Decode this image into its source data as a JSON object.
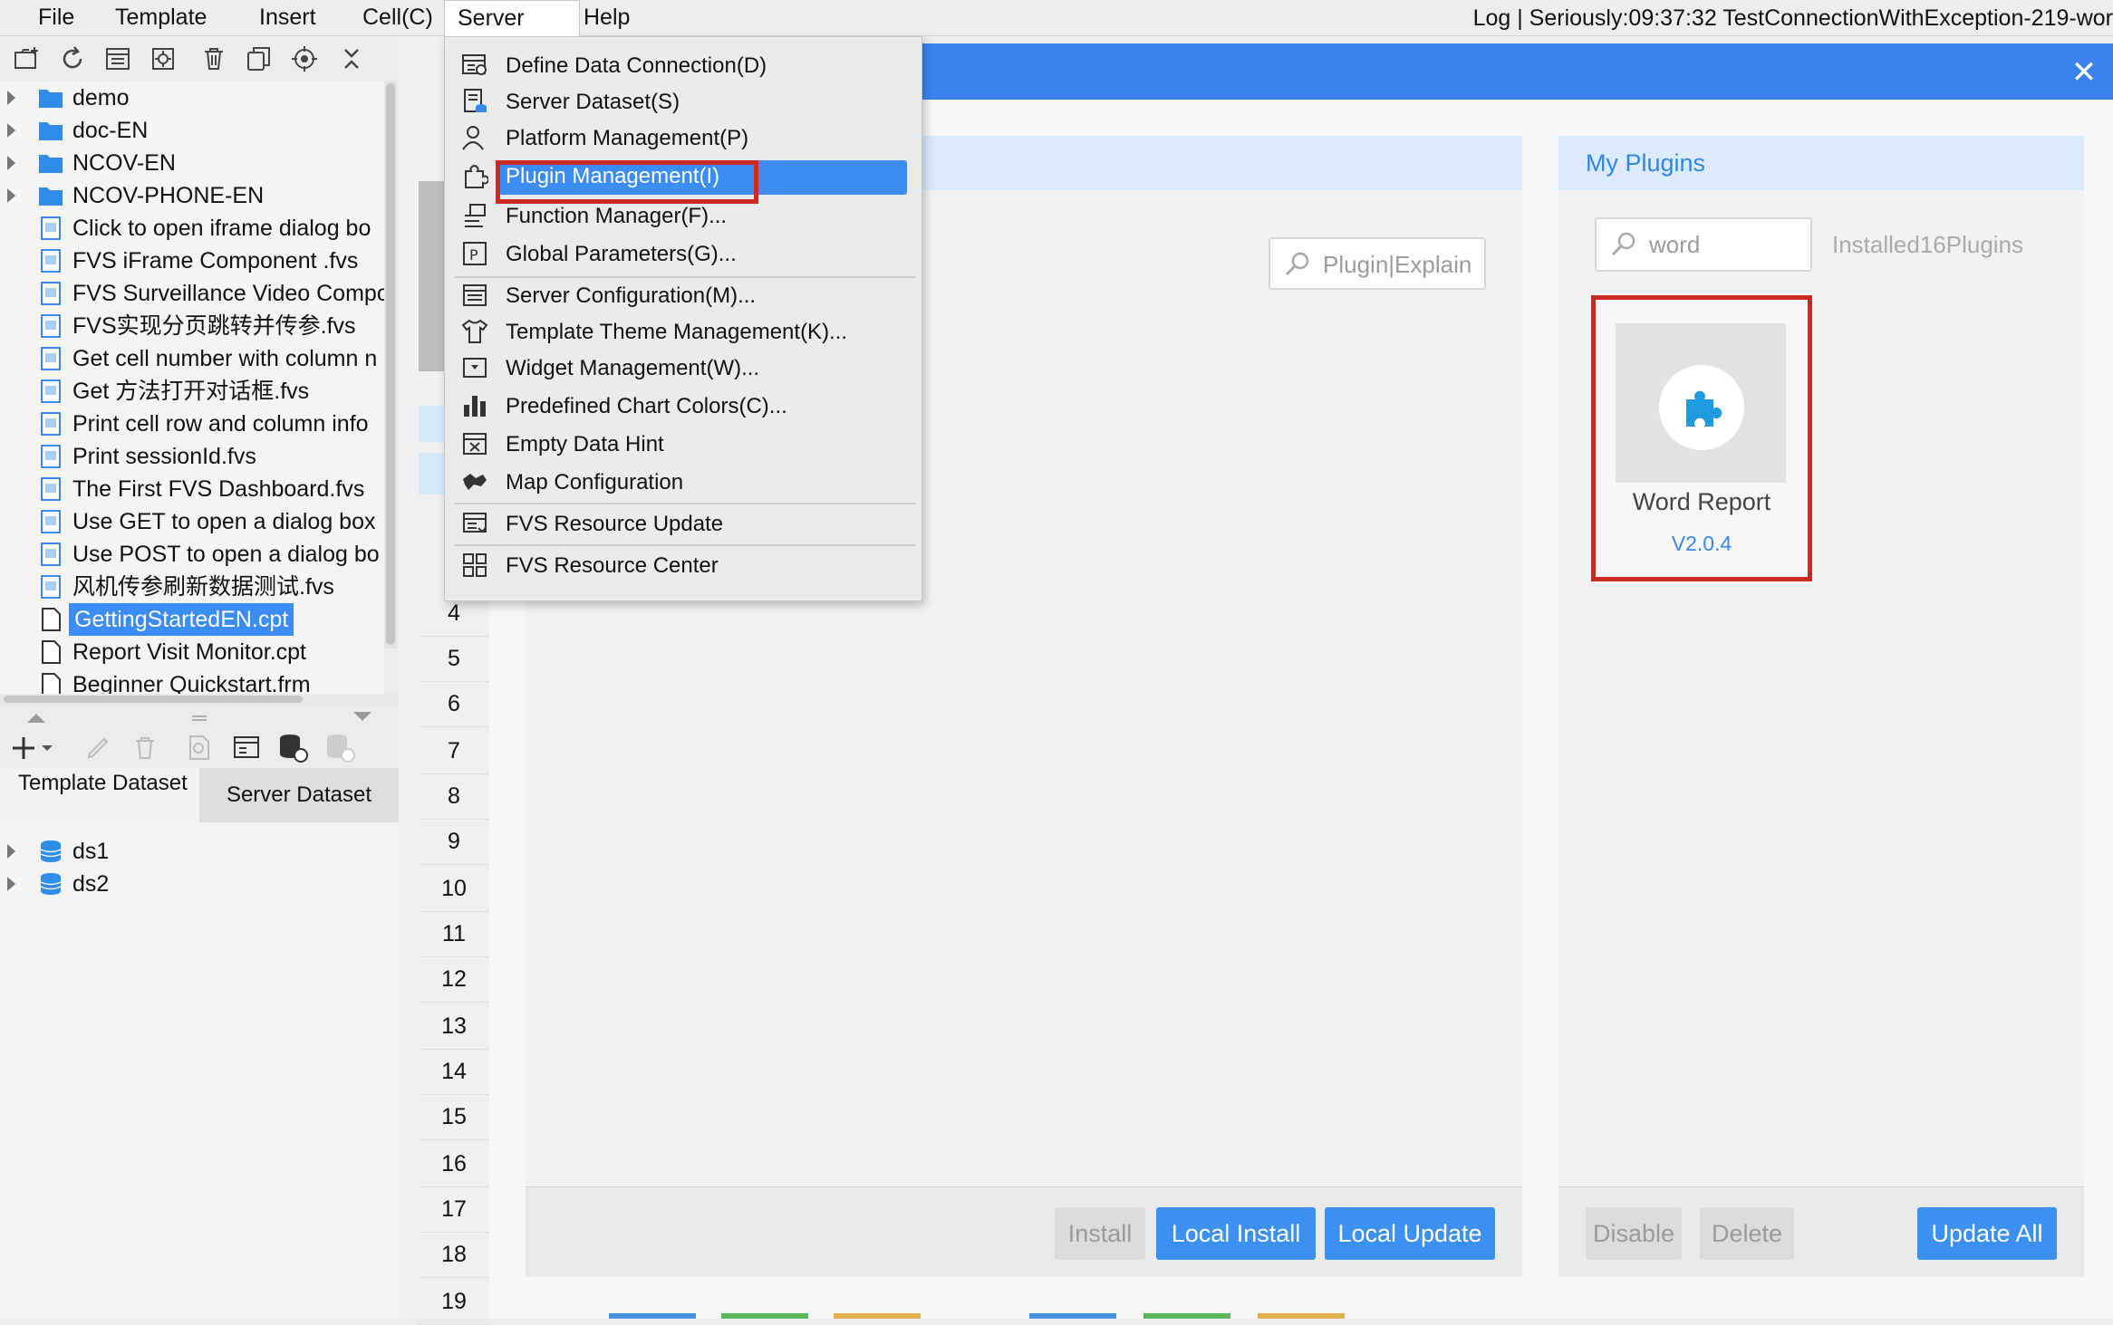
{
  "menubar": {
    "items": [
      "File",
      "Template",
      "Insert",
      "Cell(C)",
      "Server",
      "Help"
    ],
    "active": "Server",
    "log_text": "Log | Seriously:09:37:32 TestConnectionWithException-219-wor"
  },
  "left_toolbar": {
    "icons": [
      "new-folder-icon",
      "refresh-icon",
      "template-list-icon",
      "settings-gear-icon",
      "delete-icon",
      "copy-icon",
      "locate-icon",
      "collapse-icon"
    ]
  },
  "file_tree": {
    "items": [
      {
        "label": "demo",
        "type": "folder",
        "expandable": true
      },
      {
        "label": "doc-EN",
        "type": "folder",
        "expandable": true
      },
      {
        "label": "NCOV-EN",
        "type": "folder",
        "expandable": true
      },
      {
        "label": "NCOV-PHONE-EN",
        "type": "folder",
        "expandable": true
      },
      {
        "label": "Click to open iframe dialog bo",
        "type": "fvs"
      },
      {
        "label": "FVS iFrame Component .fvs",
        "type": "fvs"
      },
      {
        "label": "FVS Surveillance Video Compo",
        "type": "fvs"
      },
      {
        "label": "FVS实现分页跳转并传参.fvs",
        "type": "fvs"
      },
      {
        "label": "Get cell number with column n",
        "type": "fvs"
      },
      {
        "label": "Get 方法打开对话框.fvs",
        "type": "fvs"
      },
      {
        "label": "Print cell row and column info",
        "type": "fvs"
      },
      {
        "label": "Print sessionId.fvs",
        "type": "fvs"
      },
      {
        "label": "The First FVS Dashboard.fvs",
        "type": "fvs"
      },
      {
        "label": "Use GET to open a dialog box",
        "type": "fvs"
      },
      {
        "label": "Use POST to open a dialog bo",
        "type": "fvs"
      },
      {
        "label": "风机传参刷新数据测试.fvs",
        "type": "fvs"
      },
      {
        "label": "GettingStartedEN.cpt",
        "type": "cpt",
        "selected": true
      },
      {
        "label": "Report Visit Monitor.cpt",
        "type": "cpt"
      },
      {
        "label": "Beginner Quickstart.frm",
        "type": "cpt"
      }
    ]
  },
  "dataset": {
    "tab_template": "Template Dataset",
    "tab_server": "Server Dataset",
    "items": [
      "ds1",
      "ds2"
    ]
  },
  "row_numbers": [
    "4",
    "5",
    "6",
    "7",
    "8",
    "9",
    "10",
    "11",
    "12",
    "13",
    "14",
    "15",
    "16",
    "17",
    "18",
    "19"
  ],
  "server_menu": {
    "items": [
      {
        "label": "Define Data Connection(D)",
        "icon": "data-connection-icon"
      },
      {
        "label": "Server Dataset(S)",
        "icon": "server-dataset-icon"
      },
      {
        "label": "Platform Management(P)",
        "icon": "user-icon"
      },
      {
        "label": "Plugin Management(I)",
        "icon": "puzzle-icon",
        "highlighted": true
      },
      {
        "label": "Function Manager(F)...",
        "icon": "function-icon"
      },
      {
        "label": "Global Parameters(G)...",
        "icon": "parameter-icon"
      },
      {
        "label": "Server Configuration(M)...",
        "icon": "server-config-icon"
      },
      {
        "label": "Template Theme Management(K)...",
        "icon": "theme-shirt-icon"
      },
      {
        "label": "Widget Management(W)...",
        "icon": "widget-icon"
      },
      {
        "label": "Predefined Chart Colors(C)...",
        "icon": "bar-chart-icon"
      },
      {
        "label": "Empty Data Hint",
        "icon": "empty-data-icon"
      },
      {
        "label": "Map Configuration",
        "icon": "map-icon"
      },
      {
        "label": "FVS Resource Update",
        "icon": "resource-update-icon"
      },
      {
        "label": "FVS Resource Center",
        "icon": "resource-center-icon"
      }
    ]
  },
  "plugin_dialog": {
    "store_search_placeholder": "Plugin|Explain",
    "buttons_store": {
      "install": "Install",
      "local_install": "Local Install",
      "local_update": "Local Update"
    },
    "my_plugins": {
      "title": "My Plugins",
      "search_value": "word",
      "installed_count": "Installed16Plugins",
      "plugin": {
        "name": "Word Report",
        "version": "V2.0.4"
      },
      "buttons": {
        "disable": "Disable",
        "delete": "Delete",
        "update_all": "Update All"
      }
    }
  },
  "colors": {
    "accent": "#3b8df5",
    "dialog_header": "#3a83ee",
    "highlight_frame": "#c92a22",
    "panel_header": "#dbeafd"
  }
}
